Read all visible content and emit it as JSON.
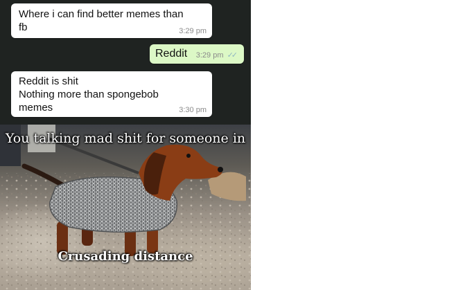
{
  "messages": [
    {
      "direction": "incoming",
      "text": "Where i can find better memes than\nfb",
      "time": "3:29 pm"
    },
    {
      "direction": "outgoing",
      "text": "Reddit",
      "time": "3:29 pm",
      "status": "read"
    },
    {
      "direction": "incoming",
      "text": "Reddit is shit\nNothing more than spongebob\nmemes",
      "time": "3:30 pm"
    }
  ],
  "meme": {
    "top_text": "You talking mad shit for someone in",
    "bottom_text": "Crusading distance",
    "subject_icon": "dachshund-in-chainmail-illustration"
  },
  "colors": {
    "chat_background": "#1f2321",
    "incoming_bubble": "#ffffff",
    "outgoing_bubble": "#dcf8c6",
    "read_ticks": "#8fb6c2"
  }
}
